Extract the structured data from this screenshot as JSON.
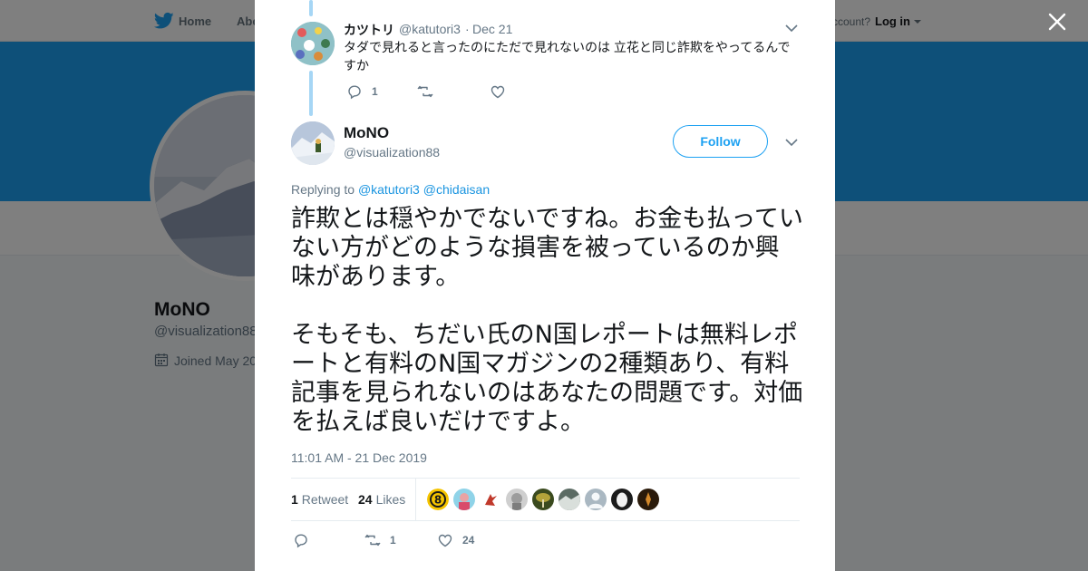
{
  "topbar": {
    "home_label": "Home",
    "about_label": "Abo",
    "account_prompt": "ccount?",
    "login_label": "Log in"
  },
  "profile": {
    "name": "MoNO",
    "handle": "@visualization88",
    "joined": "Joined May 20"
  },
  "reply_tweet": {
    "author_name": "カツトリ",
    "author_handle": "@katutori3",
    "separator": "·",
    "date": "Dec 21",
    "text": "タダで見れると言ったのにただで見れないのは 立花と同じ詐欺をやってるんですか",
    "reply_count": "1",
    "retweet_count": "",
    "like_count": ""
  },
  "main_tweet": {
    "author_name": "MoNO",
    "author_handle": "@visualization88",
    "follow_label": "Follow",
    "replying_prefix": "Replying to",
    "replying_mentions": [
      "@katutori3",
      "@chidaisan"
    ],
    "text": "詐欺とは穏やかでないですね。お金も払っていない方がどのような損害を被っているのか興味があります。\n\nそもそも、ちだい氏のN国レポートは無料レポートと有料のN国マガジンの2種類あり、有料記事を見られないのはあなたの問題です。対価を払えば良いだけですよ。",
    "timestamp": "11:01 AM - 21 Dec 2019",
    "retweets_count": "1",
    "retweets_label": "Retweet",
    "likes_count": "24",
    "likes_label": "Likes",
    "action_reply_count": "",
    "action_retweet_count": "1",
    "action_like_count": "24"
  },
  "likers": [
    {
      "icon": "liker-avatar-number-8",
      "color": "#f5c400"
    },
    {
      "icon": "liker-avatar-photo-1",
      "color": "#e9a3a3"
    },
    {
      "icon": "liker-avatar-photo-2",
      "color": "#ffffff"
    },
    {
      "icon": "liker-avatar-photo-3",
      "color": "#9c9c9c"
    },
    {
      "icon": "liker-avatar-photo-4",
      "color": "#7a8a2e"
    },
    {
      "icon": "liker-avatar-photo-5",
      "color": "#5b6b63"
    },
    {
      "icon": "liker-avatar-default",
      "color": "#aab8c2"
    },
    {
      "icon": "liker-avatar-egg",
      "color": "#1c1c1c"
    },
    {
      "icon": "liker-avatar-photo-6",
      "color": "#2a1a0a"
    }
  ],
  "colors": {
    "twitter_blue": "#1da1f2",
    "link_blue": "#1b95e0",
    "thread_line": "#a6d6f5",
    "secondary_text": "#657786",
    "overlay": "rgba(0,0,0,0.5)"
  },
  "icons": [
    "twitter-bird-icon",
    "calendar-icon",
    "close-icon",
    "chevron-down-icon",
    "reply-icon",
    "retweet-icon",
    "like-icon"
  ]
}
